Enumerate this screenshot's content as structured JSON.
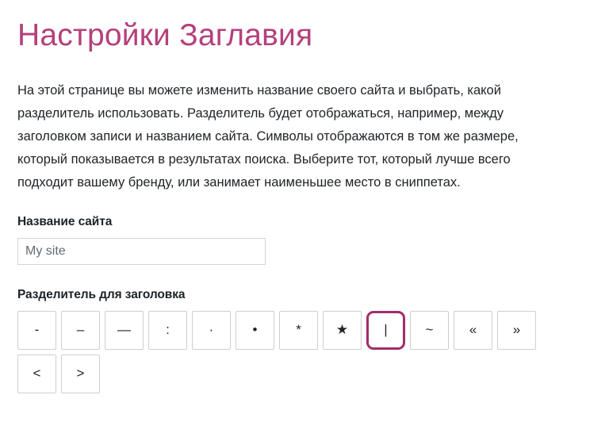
{
  "page": {
    "title": "Настройки Заглавия",
    "intro": "На этой странице вы можете изменить название своего сайта и выбрать, какой разделитель использовать. Разделитель будет отображаться, например, между заголовком записи и названием сайта. Символы отображаются в том же размере, который показывается в результатах поиска. Выберите тот, который лучше всего подходит вашему бренду, или занимает наименьшее место в сниппетах."
  },
  "site_title_field": {
    "label": "Название сайта",
    "value": "",
    "placeholder": "My site"
  },
  "separator_field": {
    "label": "Разделитель для заголовка",
    "selected": "|",
    "options": [
      {
        "glyph": "-",
        "name": "hyphen"
      },
      {
        "glyph": "–",
        "name": "en-dash"
      },
      {
        "glyph": "—",
        "name": "em-dash"
      },
      {
        "glyph": ":",
        "name": "colon"
      },
      {
        "glyph": "·",
        "name": "middle-dot"
      },
      {
        "glyph": "•",
        "name": "bullet"
      },
      {
        "glyph": "*",
        "name": "asterisk"
      },
      {
        "glyph": "★",
        "name": "star"
      },
      {
        "glyph": "|",
        "name": "pipe"
      },
      {
        "glyph": "~",
        "name": "tilde"
      },
      {
        "glyph": "«",
        "name": "left-double-angle-quote"
      },
      {
        "glyph": "»",
        "name": "right-double-angle-quote"
      },
      {
        "glyph": "<",
        "name": "less-than"
      },
      {
        "glyph": ">",
        "name": "greater-than"
      }
    ]
  },
  "colors": {
    "accent": "#a32c69",
    "title": "#b5407c",
    "text": "#1f2327",
    "border": "#cfcfcf"
  }
}
